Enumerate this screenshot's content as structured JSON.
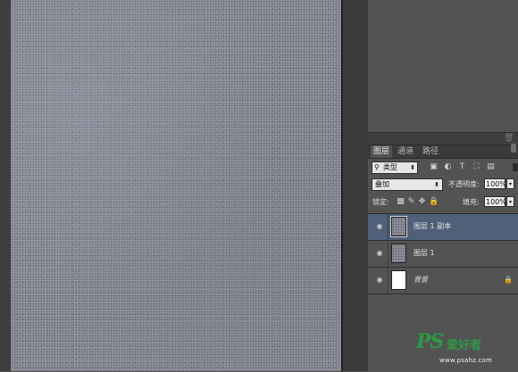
{
  "layers_panel": {
    "tabs": [
      {
        "label": "图层",
        "active": true
      },
      {
        "label": "通道",
        "active": false
      },
      {
        "label": "路径",
        "active": false
      }
    ],
    "filter": {
      "kind_label": "类型",
      "icons": [
        "image-filter-icon",
        "adjustment-filter-icon",
        "type-filter-icon",
        "shape-filter-icon",
        "smart-object-filter-icon"
      ]
    },
    "blend_mode": "叠加",
    "opacity_label": "不透明度:",
    "opacity_value": "100%",
    "lock_label": "锁定:",
    "fill_label": "填充:",
    "fill_value": "100%",
    "layers": [
      {
        "name": "图层 1 副本",
        "selected": true,
        "thumb": "texture",
        "locked": false
      },
      {
        "name": "图层 1",
        "selected": false,
        "thumb": "texture",
        "locked": false
      },
      {
        "name": "背景",
        "selected": false,
        "thumb": "white",
        "locked": true
      }
    ]
  },
  "watermark": {
    "logo": "PS",
    "site_name": "爱好者",
    "url": "www.psahz.com"
  },
  "colors": {
    "panel_bg": "#535353",
    "selected_layer": "#4f6078",
    "watermark_green": "#2c9a46"
  }
}
